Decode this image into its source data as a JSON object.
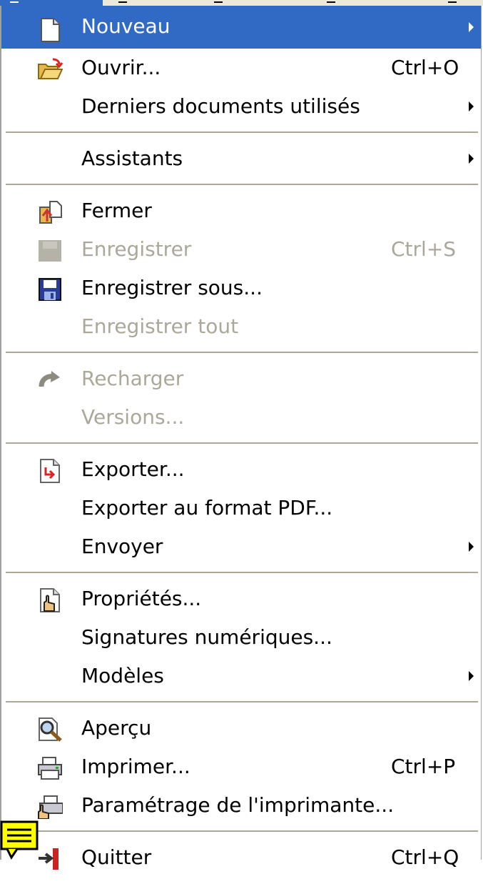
{
  "menu": {
    "items": [
      {
        "type": "item",
        "label": "Nouveau",
        "underline": "N",
        "shortcut": "",
        "submenu": true,
        "highlighted": true,
        "disabled": false,
        "icon": "new-document-icon"
      },
      {
        "type": "item",
        "label": "Ouvrir...",
        "shortcut": "Ctrl+O",
        "submenu": false,
        "highlighted": false,
        "disabled": false,
        "icon": "open-folder-icon"
      },
      {
        "type": "item",
        "label": "Derniers documents utilisés",
        "shortcut": "",
        "submenu": true,
        "highlighted": false,
        "disabled": false,
        "icon": ""
      },
      {
        "type": "separator"
      },
      {
        "type": "item",
        "label": "Assistants",
        "shortcut": "",
        "submenu": true,
        "highlighted": false,
        "disabled": false,
        "icon": ""
      },
      {
        "type": "separator"
      },
      {
        "type": "item",
        "label": "Fermer",
        "shortcut": "",
        "submenu": false,
        "highlighted": false,
        "disabled": false,
        "icon": "close-document-icon"
      },
      {
        "type": "item",
        "label": "Enregistrer",
        "shortcut": "Ctrl+S",
        "submenu": false,
        "highlighted": false,
        "disabled": true,
        "icon": "save-disabled-icon"
      },
      {
        "type": "item",
        "label": "Enregistrer sous...",
        "shortcut": "",
        "submenu": false,
        "highlighted": false,
        "disabled": false,
        "icon": "save-as-icon"
      },
      {
        "type": "item",
        "label": "Enregistrer tout",
        "shortcut": "",
        "submenu": false,
        "highlighted": false,
        "disabled": true,
        "icon": ""
      },
      {
        "type": "separator"
      },
      {
        "type": "item",
        "label": "Recharger",
        "shortcut": "",
        "submenu": false,
        "highlighted": false,
        "disabled": true,
        "icon": "reload-icon"
      },
      {
        "type": "item",
        "label": "Versions...",
        "shortcut": "",
        "submenu": false,
        "highlighted": false,
        "disabled": true,
        "icon": ""
      },
      {
        "type": "separator"
      },
      {
        "type": "item",
        "label": "Exporter...",
        "shortcut": "",
        "submenu": false,
        "highlighted": false,
        "disabled": false,
        "icon": "export-icon"
      },
      {
        "type": "item",
        "label": "Exporter au format PDF...",
        "shortcut": "",
        "submenu": false,
        "highlighted": false,
        "disabled": false,
        "icon": ""
      },
      {
        "type": "item",
        "label": "Envoyer",
        "shortcut": "",
        "submenu": true,
        "highlighted": false,
        "disabled": false,
        "icon": ""
      },
      {
        "type": "separator"
      },
      {
        "type": "item",
        "label": "Propriétés...",
        "shortcut": "",
        "submenu": false,
        "highlighted": false,
        "disabled": false,
        "icon": "properties-icon"
      },
      {
        "type": "item",
        "label": "Signatures numériques...",
        "shortcut": "",
        "submenu": false,
        "highlighted": false,
        "disabled": false,
        "icon": ""
      },
      {
        "type": "item",
        "label": "Modèles",
        "shortcut": "",
        "submenu": true,
        "highlighted": false,
        "disabled": false,
        "icon": ""
      },
      {
        "type": "separator"
      },
      {
        "type": "item",
        "label": "Aperçu",
        "shortcut": "",
        "submenu": false,
        "highlighted": false,
        "disabled": false,
        "icon": "preview-magnifier-icon"
      },
      {
        "type": "item",
        "label": "Imprimer...",
        "shortcut": "Ctrl+P",
        "submenu": false,
        "highlighted": false,
        "disabled": false,
        "icon": "printer-icon"
      },
      {
        "type": "item",
        "label": "Paramétrage de l'imprimante...",
        "shortcut": "",
        "submenu": false,
        "highlighted": false,
        "disabled": false,
        "icon": "printer-settings-icon"
      },
      {
        "type": "separator"
      },
      {
        "type": "item",
        "label": "Quitter",
        "shortcut": "Ctrl+Q",
        "submenu": false,
        "highlighted": false,
        "disabled": false,
        "icon": "exit-icon"
      }
    ]
  },
  "colors": {
    "highlight_bg": "#316ac5",
    "highlight_text": "#ffffff",
    "disabled_text": "#aca899",
    "separator": "#aca899",
    "menubar": "#ece9d8"
  }
}
